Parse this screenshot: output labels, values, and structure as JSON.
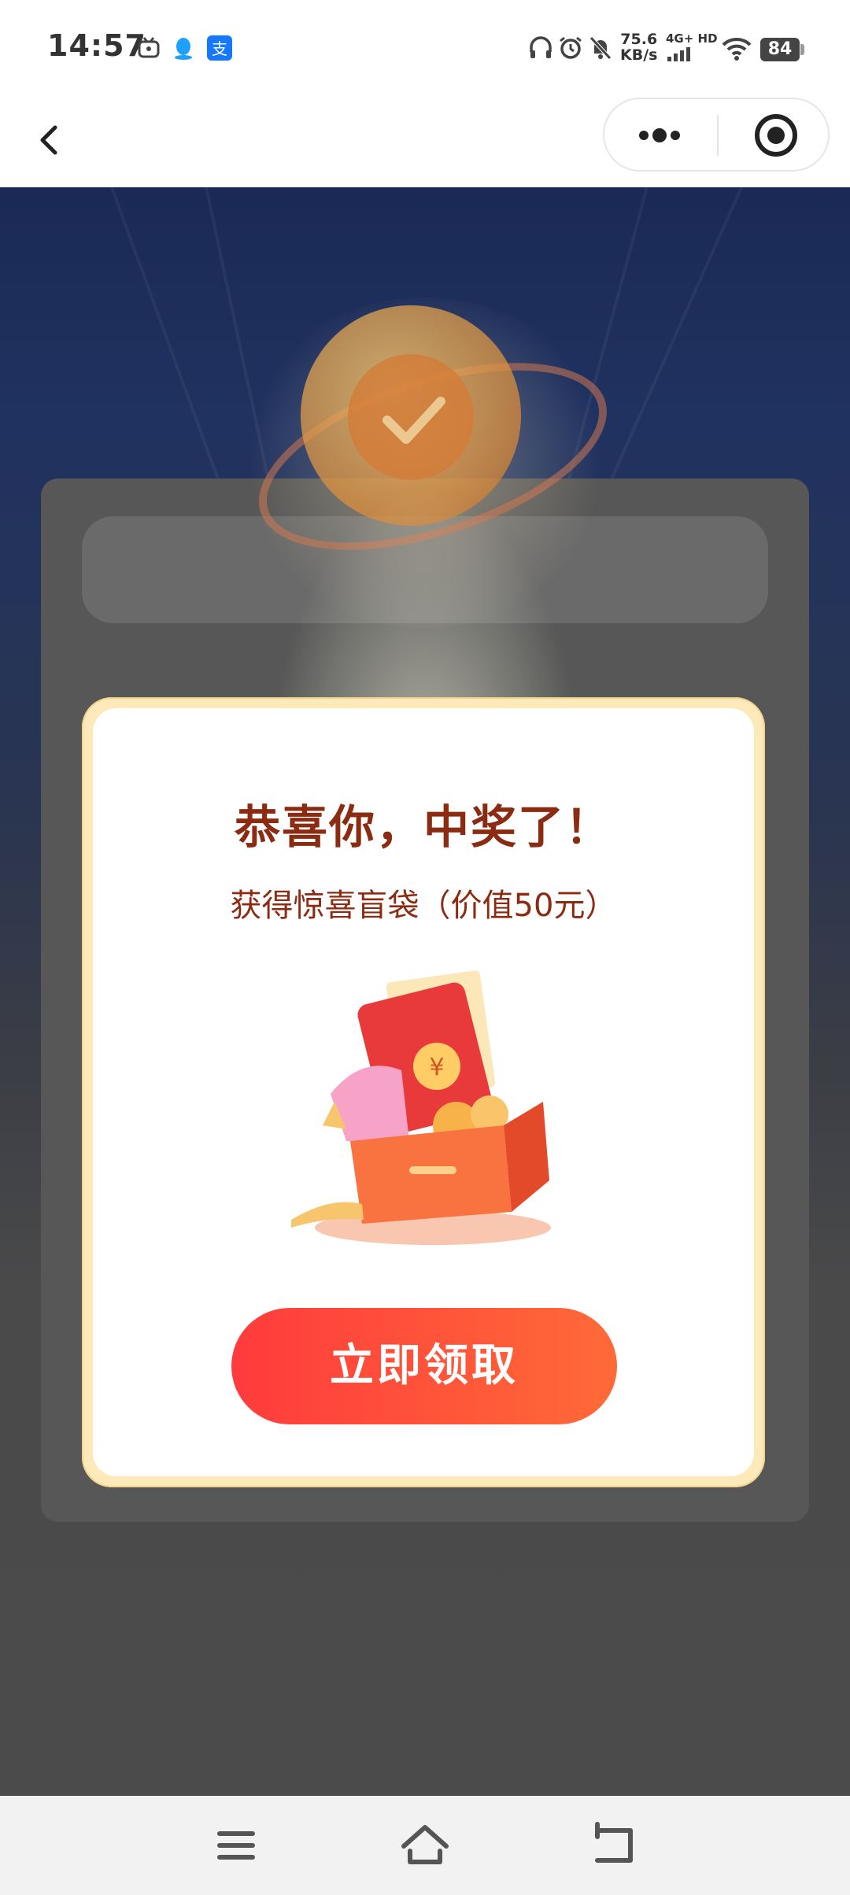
{
  "status_bar": {
    "time": "14:57",
    "speed_value": "75.6",
    "speed_unit": "KB/s",
    "network": "4G+ HD",
    "battery": "84",
    "icons": [
      "tv-icon",
      "qq-icon",
      "alipay-icon",
      "headphones-icon",
      "alarm-icon",
      "bell-muted-icon",
      "signal-icon",
      "wifi-icon"
    ]
  },
  "nav": {
    "back_icon": "chevron-left-icon",
    "more_icon": "ellipsis-icon",
    "close_icon": "target-icon"
  },
  "popup": {
    "title": "恭喜你，中奖了！",
    "subtitle": "获得惊喜盲袋（价值50元）",
    "claim_label": "立即领取",
    "colors": {
      "title": "#8b2b12",
      "button_start": "#ff3b3d",
      "button_end": "#ff6a37",
      "border": "#fde9b9"
    }
  },
  "system_nav": {
    "menu_icon": "menu-icon",
    "home_icon": "home-icon",
    "back_icon": "back-arrow-icon"
  }
}
